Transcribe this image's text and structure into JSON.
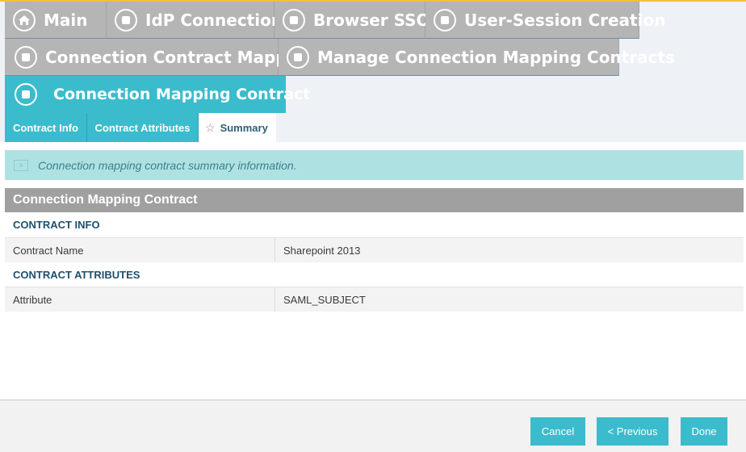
{
  "breadcrumbs": {
    "row1": [
      {
        "label": "Main",
        "icon": "home-icon"
      },
      {
        "label": "IdP Connection",
        "icon": "stop-circle-icon"
      },
      {
        "label": "Browser SSO",
        "icon": "stop-circle-icon"
      },
      {
        "label": "User-Session Creation",
        "icon": "stop-circle-icon"
      }
    ],
    "row2": [
      {
        "label": "Connection Contract Mapping",
        "icon": "stop-circle-icon"
      },
      {
        "label": "Manage Connection Mapping Contracts",
        "icon": "stop-circle-icon"
      }
    ],
    "current": {
      "label": "Connection Mapping Contract",
      "icon": "stop-circle-icon"
    }
  },
  "subtabs": [
    {
      "label": "Contract Info"
    },
    {
      "label": "Contract Attributes"
    },
    {
      "label": "Summary",
      "icon": "star-icon"
    }
  ],
  "info_message": "Connection mapping contract summary information.",
  "panel": {
    "title": "Connection Mapping Contract",
    "sections": [
      {
        "title": "CONTRACT INFO",
        "rows": [
          {
            "label": "Contract Name",
            "value": "Sharepoint 2013"
          }
        ]
      },
      {
        "title": "CONTRACT ATTRIBUTES",
        "rows": [
          {
            "label": "Attribute",
            "value": "SAML_SUBJECT"
          }
        ]
      }
    ]
  },
  "buttons": {
    "cancel": "Cancel",
    "previous": "< Previous",
    "done": "Done"
  },
  "colors": {
    "accent": "#3bbccc",
    "inactive_tab": "#b5b5b5",
    "info_bg": "#aee2e2",
    "section_title": "#1d4f6e",
    "top_line": "#f1c232"
  }
}
